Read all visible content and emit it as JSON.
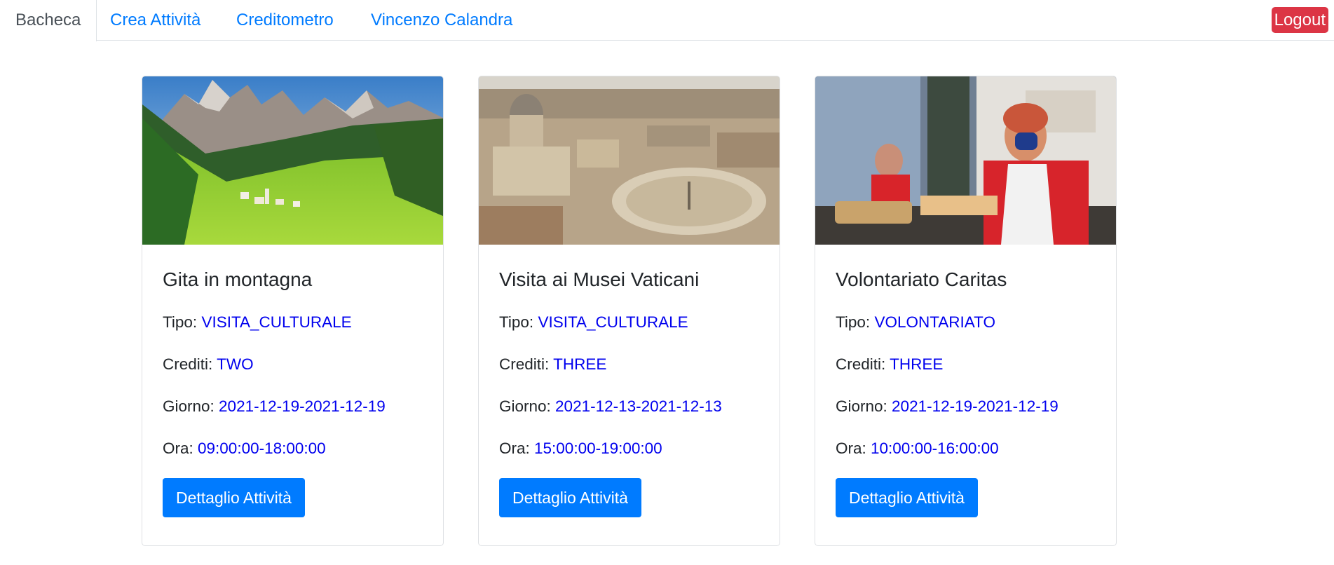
{
  "nav": {
    "tabs": [
      {
        "label": "Bacheca"
      },
      {
        "label": "Crea Attività"
      },
      {
        "label": "Creditometro"
      },
      {
        "label": "Vincenzo Calandra"
      }
    ],
    "logout_label": "Logout"
  },
  "colors": {
    "link": "#007bff",
    "value": "#0000ee",
    "button": "#007bff",
    "logout": "#dc3545"
  },
  "cards": [
    {
      "image": "mountain-village-photo",
      "title": "Gita in montagna",
      "tipo_label": "Tipo: ",
      "tipo": "VISITA_CULTURALE",
      "crediti_label": "Crediti: ",
      "crediti": "TWO",
      "giorno_label": "Giorno: ",
      "giorno": "2021-12-19-2021-12-19",
      "ora_label": "Ora: ",
      "ora": "09:00:00-18:00:00",
      "button": "Dettaglio Attività"
    },
    {
      "image": "vatican-aerial-photo",
      "title": "Visita ai Musei Vaticani",
      "tipo_label": "Tipo: ",
      "tipo": "VISITA_CULTURALE",
      "crediti_label": "Crediti: ",
      "crediti": "THREE",
      "giorno_label": "Giorno: ",
      "giorno": "2021-12-13-2021-12-13",
      "ora_label": "Ora: ",
      "ora": "15:00:00-19:00:00",
      "button": "Dettaglio Attività"
    },
    {
      "image": "caritas-volunteer-photo",
      "title": "Volontariato Caritas",
      "tipo_label": "Tipo: ",
      "tipo": "VOLONTARIATO",
      "crediti_label": "Crediti: ",
      "crediti": "THREE",
      "giorno_label": "Giorno: ",
      "giorno": "2021-12-19-2021-12-19",
      "ora_label": "Ora: ",
      "ora": "10:00:00-16:00:00",
      "button": "Dettaglio Attività"
    }
  ]
}
